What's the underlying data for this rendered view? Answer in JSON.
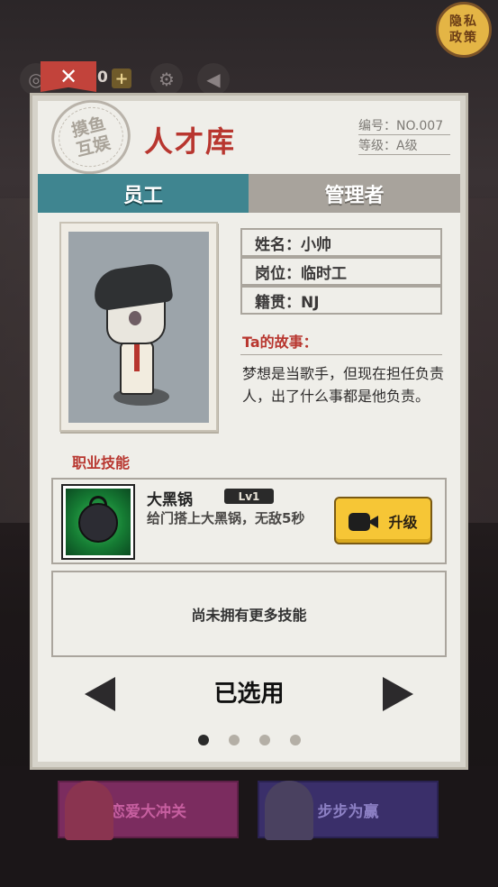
{
  "privacy": {
    "line1": "隐私",
    "line2": "政策"
  },
  "hud": {
    "count": "0",
    "plus": "+"
  },
  "stamp": {
    "line1": "摸鱼",
    "line2": "互娱"
  },
  "title": "人才库",
  "meta": {
    "number": "编号：NO.007",
    "grade": "等级：A级"
  },
  "tabs": {
    "staff": "员工",
    "manager": "管理者"
  },
  "info": {
    "name": "姓名：小帅",
    "position": "岗位：临时工",
    "origin": "籍贯：NJ"
  },
  "story": {
    "title": "Ta的故事：",
    "text": "梦想是当歌手，但现在担任负责人，出了什么事都是他负责。"
  },
  "skills": {
    "title": "职业技能",
    "skill": {
      "name": "大黑锅",
      "level": "Lv1",
      "desc": "给门搭上大黑锅，无敌5秒",
      "upgrade": "升级"
    },
    "no_more": "尚未拥有更多技能"
  },
  "selected": "已选用",
  "pages": {
    "total": 4,
    "current": 1
  },
  "bottom": {
    "love": "恋爱大冲关",
    "step": "步步为赢"
  }
}
